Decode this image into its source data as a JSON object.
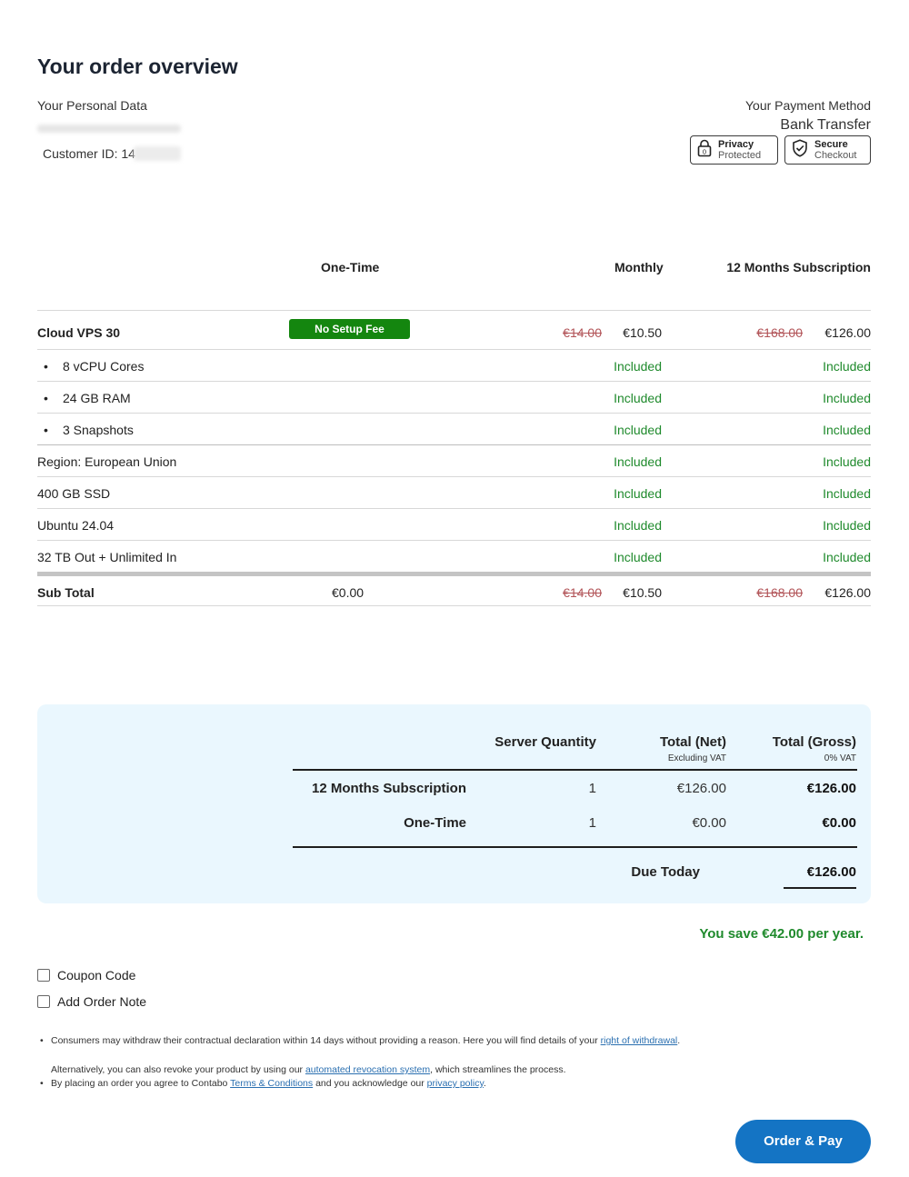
{
  "page": {
    "title": "Your order overview"
  },
  "personal": {
    "label": "Your Personal Data",
    "customer_id_label": "Customer ID: 14"
  },
  "payment": {
    "label": "Your Payment Method",
    "method": "Bank Transfer",
    "badges": [
      {
        "title": "Privacy",
        "sub": "Protected"
      },
      {
        "title": "Secure",
        "sub": "Checkout"
      }
    ]
  },
  "table": {
    "headers": {
      "one_time": "One-Time",
      "monthly": "Monthly",
      "subscription": "12 Months Subscription"
    },
    "product": {
      "name": "Cloud VPS 30",
      "badge": "No Setup Fee",
      "monthly_old": "€14.00",
      "monthly_new": "€10.50",
      "sub_old": "€168.00",
      "sub_new": "€126.00"
    },
    "rows": [
      {
        "label": "8 vCPU Cores",
        "monthly": "Included",
        "sub": "Included"
      },
      {
        "label": "24 GB RAM",
        "monthly": "Included",
        "sub": "Included"
      },
      {
        "label": "3 Snapshots",
        "monthly": "Included",
        "sub": "Included"
      },
      {
        "label": "Region: European Union",
        "monthly": "Included",
        "sub": "Included"
      },
      {
        "label": "400 GB SSD",
        "monthly": "Included",
        "sub": "Included"
      },
      {
        "label": "Ubuntu 24.04",
        "monthly": "Included",
        "sub": "Included"
      },
      {
        "label": "32 TB Out + Unlimited In",
        "monthly": "Included",
        "sub": "Included"
      }
    ],
    "subtotal": {
      "label": "Sub Total",
      "one_time": "€0.00",
      "monthly_old": "€14.00",
      "monthly_new": "€10.50",
      "sub_old": "€168.00",
      "sub_new": "€126.00"
    }
  },
  "summary": {
    "headers": {
      "quantity": "Server Quantity",
      "net": "Total (Net)",
      "net_sub": "Excluding VAT",
      "gross": "Total (Gross)",
      "gross_sub": "0% VAT"
    },
    "lines": [
      {
        "label": "12 Months Subscription",
        "qty": "1",
        "net": "€126.00",
        "gross": "€126.00"
      },
      {
        "label": "One-Time",
        "qty": "1",
        "net": "€0.00",
        "gross": "€0.00"
      }
    ],
    "due_label": "Due Today",
    "due_value": "€126.00"
  },
  "savings": "You save €42.00 per year.",
  "options": {
    "coupon": "Coupon Code",
    "note": "Add Order Note"
  },
  "legal": {
    "line1_pre": "Consumers may withdraw their contractual declaration within 14 days without providing a reason. Here you will find details of your ",
    "line1_link": "right of withdrawal",
    "line1_post": ".",
    "line2_pre": "Alternatively, you can also revoke your product by using our ",
    "line2_link": "automated revocation system",
    "line2_post": ", which streamlines the process.",
    "line3_pre": "By placing an order you agree to Contabo ",
    "line3_link1": "Terms & Conditions",
    "line3_mid": " and you acknowledge our ",
    "line3_link2": "privacy policy",
    "line3_post": "."
  },
  "actions": {
    "order": "Order & Pay"
  }
}
